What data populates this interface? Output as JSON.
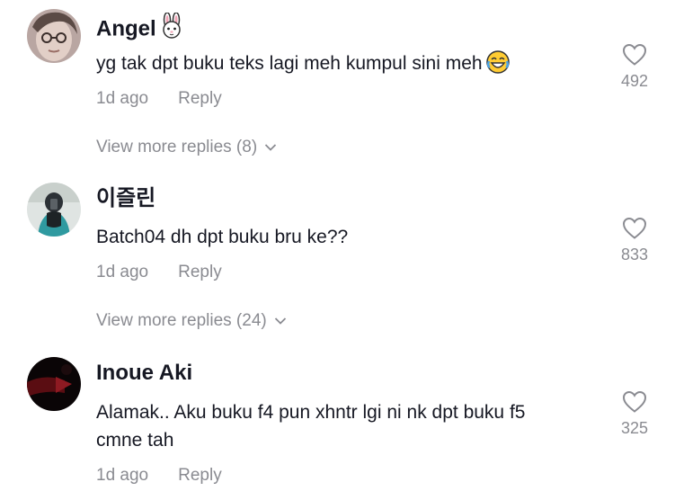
{
  "comments": [
    {
      "author": "Angel",
      "author_emoji": "rabbit-face-icon",
      "text": "yg tak dpt buku teks lagi meh kumpul sini meh",
      "text_emoji": "tears-of-joy-icon",
      "time": "1d ago",
      "reply_label": "Reply",
      "likes": "492",
      "more_replies": "View more replies (8)"
    },
    {
      "author": "이즐린",
      "text": "Batch04 dh dpt buku bru ke??",
      "time": "1d ago",
      "reply_label": "Reply",
      "likes": "833",
      "more_replies": "View more replies (24)"
    },
    {
      "author": "Inoue Aki",
      "text_line1": "Alamak.. Aku buku f4 pun xhntr lgi ni nk dpt buku f5",
      "text_line2": "cmne tah",
      "time": "1d ago",
      "reply_label": "Reply",
      "likes": "325"
    }
  ],
  "colors": {
    "primary_text": "#161823",
    "secondary_text": "#8a8b91"
  }
}
